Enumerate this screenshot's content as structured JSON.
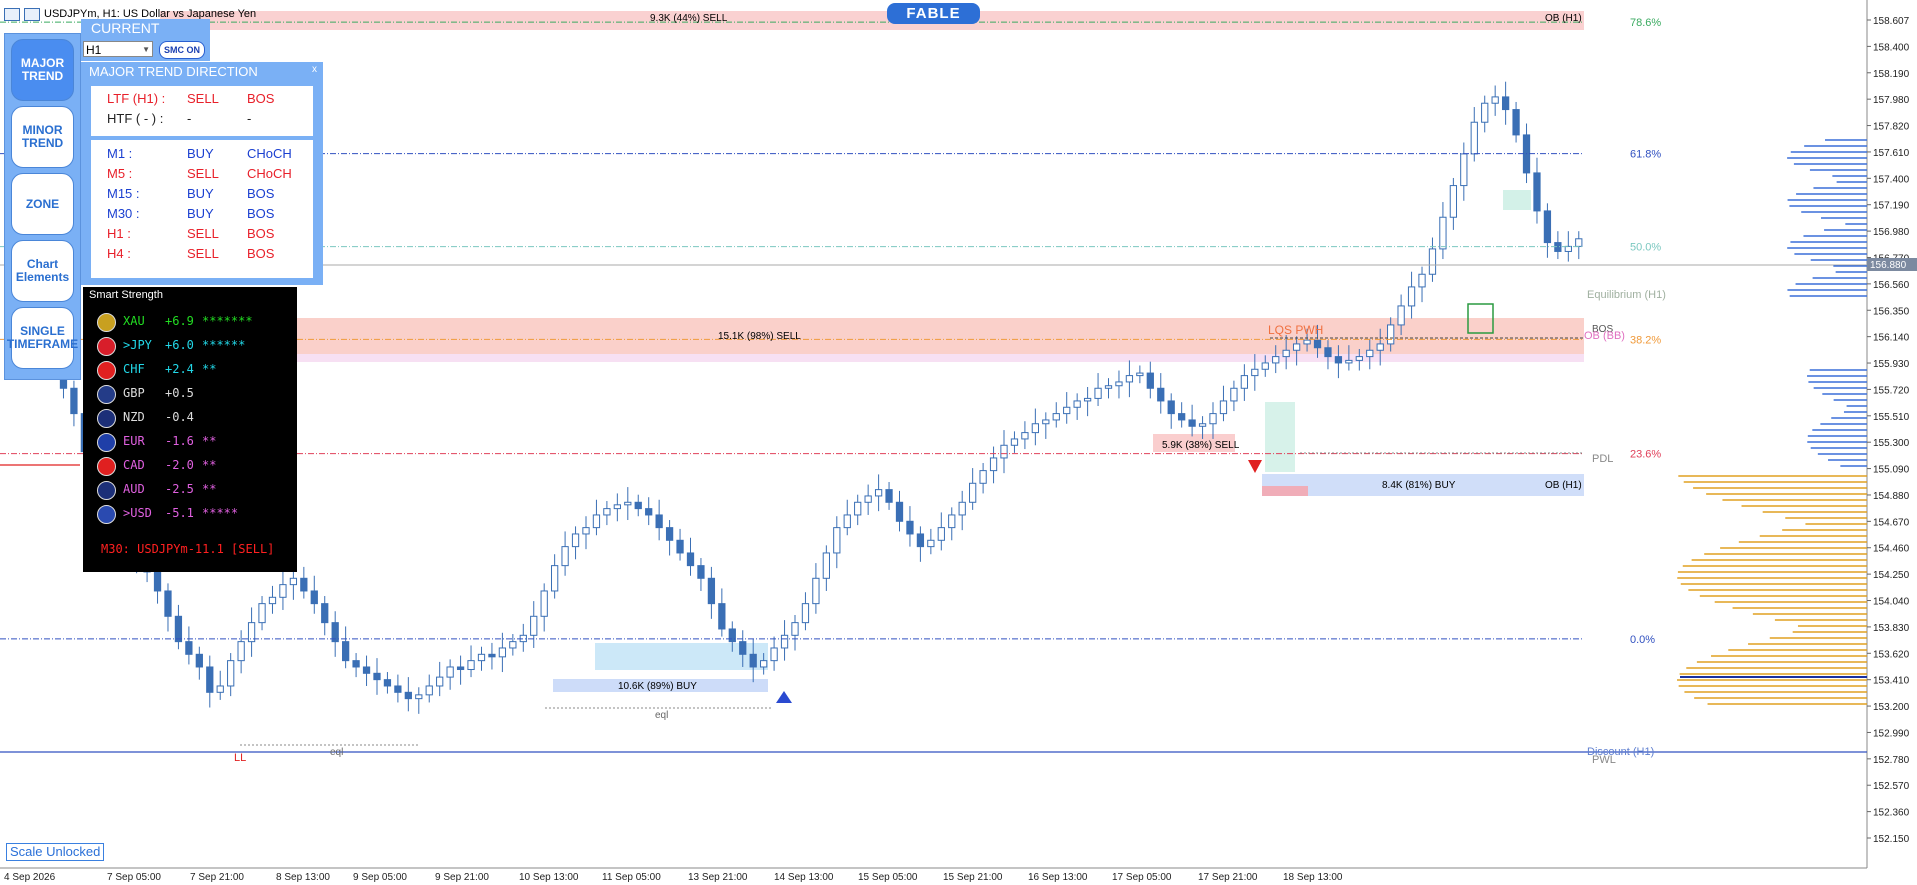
{
  "window": {
    "title": "USDJPYm, H1:  US Dollar vs Japanese Yen"
  },
  "brand": {
    "label": "FABLE"
  },
  "sidebar": {
    "items": [
      {
        "label": "MAJOR TREND",
        "active": true
      },
      {
        "label": "MINOR TREND",
        "active": false
      },
      {
        "label": "ZONE",
        "active": false
      },
      {
        "label": "Chart Elements",
        "active": false
      },
      {
        "label": "SINGLE TIMEFRAME",
        "active": false
      }
    ]
  },
  "current": {
    "title": "CURRENT",
    "timeframe": "H1",
    "smc_button": "SMC ON"
  },
  "trend": {
    "title": "MAJOR TREND DIRECTION",
    "close": "x",
    "ltf": {
      "label": "LTF (H1) :",
      "dir": "SELL",
      "struct": "BOS"
    },
    "htf": {
      "label": "HTF ( - ) :",
      "dir": "-",
      "struct": "-"
    },
    "rows": [
      {
        "tf": "M1 :",
        "dir": "BUY",
        "struct": "CHoCH",
        "color": "#1a3fd0"
      },
      {
        "tf": "M5 :",
        "dir": "SELL",
        "struct": "CHoCH",
        "color": "#e8202a"
      },
      {
        "tf": "M15 :",
        "dir": "BUY",
        "struct": "BOS",
        "color": "#1a3fd0"
      },
      {
        "tf": "M30 :",
        "dir": "BUY",
        "struct": "BOS",
        "color": "#1a3fd0"
      },
      {
        "tf": "H1 :",
        "dir": "SELL",
        "struct": "BOS",
        "color": "#e8202a"
      },
      {
        "tf": "H4 :",
        "dir": "SELL",
        "struct": "BOS",
        "color": "#e8202a"
      }
    ]
  },
  "strength": {
    "title": "Smart Strength",
    "rows": [
      {
        "cur": "XAU",
        "val": "+6.9",
        "stars": "*******",
        "color": "#22dd22",
        "flag": "#c8a020"
      },
      {
        "cur": ">JPY",
        "val": "+6.0",
        "stars": "******",
        "color": "#22d8e8",
        "flag": "#d81e2a"
      },
      {
        "cur": "CHF",
        "val": "+2.4",
        "stars": "**",
        "color": "#22d8e8",
        "flag": "#e02020"
      },
      {
        "cur": "GBP",
        "val": "+0.5",
        "stars": "",
        "color": "#dddddd",
        "flag": "#243c88"
      },
      {
        "cur": "NZD",
        "val": "-0.4",
        "stars": "",
        "color": "#dddddd",
        "flag": "#1c2f78"
      },
      {
        "cur": "EUR",
        "val": "-1.6",
        "stars": "**",
        "color": "#e060e0",
        "flag": "#1f3fa8"
      },
      {
        "cur": "CAD",
        "val": "-2.0",
        "stars": "**",
        "color": "#e060e0",
        "flag": "#e02020"
      },
      {
        "cur": "AUD",
        "val": "-2.5",
        "stars": "**",
        "color": "#e060e0",
        "flag": "#1c2f78"
      },
      {
        "cur": ">USD",
        "val": "-5.1",
        "stars": "*****",
        "color": "#e060e0",
        "flag": "#2a4ab0"
      }
    ],
    "signal": "M30: USDJPYm-11.1 [SELL]"
  },
  "scale_button": "Scale Unlocked",
  "chart_data": {
    "type": "candlestick",
    "symbol": "USDJPYm",
    "timeframe": "H1",
    "y_ticks": [
      "158.607",
      "158.400",
      "158.190",
      "157.980",
      "157.820",
      "157.610",
      "157.400",
      "157.190",
      "156.980",
      "156.770",
      "156.560",
      "156.350",
      "156.140",
      "155.930",
      "155.720",
      "155.510",
      "155.300",
      "155.090",
      "154.880",
      "154.670",
      "154.460",
      "154.250",
      "154.040",
      "153.830",
      "153.620",
      "153.410",
      "153.200",
      "152.990",
      "152.780",
      "152.570",
      "152.360",
      "152.150"
    ],
    "ylim": [
      152.07,
      158.7
    ],
    "x_ticks": [
      "4 Sep 2026",
      "7 Sep 05:00",
      "7 Sep 21:00",
      "8 Sep 13:00",
      "9 Sep 05:00",
      "9 Sep 21:00",
      "10 Sep 13:00",
      "11 Sep 05:00",
      "13 Sep 21:00",
      "14 Sep 13:00",
      "15 Sep 05:00",
      "15 Sep 21:00",
      "16 Sep 13:00",
      "17 Sep 05:00",
      "17 Sep 21:00",
      "18 Sep 13:00"
    ],
    "current_price": "156.880",
    "fib_levels": [
      {
        "label": "78.6%",
        "price": 158.59,
        "color": "#3aaa60"
      },
      {
        "label": "61.8%",
        "price": 157.552,
        "color": "#3050c0"
      },
      {
        "label": "50.0%",
        "price": 156.818,
        "color": "#7bc8c0"
      },
      {
        "label": "38.2%",
        "price": 156.086,
        "color": "#f09a3a"
      },
      {
        "label": "23.6%",
        "price": 155.184,
        "color": "#e0405a"
      },
      {
        "label": "0.0%",
        "price": 153.722,
        "color": "#3050c0"
      }
    ],
    "labels": {
      "ob_top": "OB (H1)",
      "ob_bottom": "OB (H1)",
      "ob_bb": "OB (BB)",
      "bos": "BOS",
      "equilibrium": "Equilibrium (H1)",
      "discount": "Discount (H1)",
      "pwl": "PWL",
      "pdl": "PDL",
      "lqs_pwh": "LQS PWH",
      "ll": "LL",
      "eql": "eql",
      "eql2": "eql",
      "zone1": "9.3K (44%) SELL",
      "zone2": "15.1K (98%) SELL",
      "zone3": "5.9K (38%) SELL",
      "zone4": "8.4K (81%) BUY",
      "zone5": "10.6K (89%) BUY"
    },
    "closes": [
      155.9,
      156.05,
      156.1,
      156.0,
      155.85,
      155.7,
      155.5,
      155.2,
      154.9,
      154.7,
      154.55,
      154.4,
      154.3,
      154.25,
      154.1,
      153.9,
      153.7,
      153.6,
      153.5,
      153.3,
      153.35,
      153.55,
      153.7,
      153.85,
      154.0,
      154.05,
      154.15,
      154.2,
      154.1,
      154.0,
      153.85,
      153.7,
      153.55,
      153.5,
      153.45,
      153.4,
      153.35,
      153.3,
      153.25,
      153.28,
      153.35,
      153.42,
      153.5,
      153.48,
      153.55,
      153.6,
      153.58,
      153.65,
      153.7,
      153.75,
      153.9,
      154.1,
      154.3,
      154.45,
      154.55,
      154.6,
      154.7,
      154.75,
      154.78,
      154.8,
      154.75,
      154.7,
      154.6,
      154.5,
      154.4,
      154.3,
      154.2,
      154.0,
      153.8,
      153.7,
      153.6,
      153.5,
      153.55,
      153.65,
      153.75,
      153.85,
      154.0,
      154.2,
      154.4,
      154.6,
      154.7,
      154.8,
      154.85,
      154.9,
      154.8,
      154.65,
      154.55,
      154.45,
      154.5,
      154.6,
      154.7,
      154.8,
      154.95,
      155.05,
      155.15,
      155.25,
      155.3,
      155.35,
      155.42,
      155.45,
      155.5,
      155.55,
      155.6,
      155.62,
      155.7,
      155.72,
      155.75,
      155.8,
      155.82,
      155.7,
      155.6,
      155.5,
      155.45,
      155.4,
      155.42,
      155.5,
      155.6,
      155.7,
      155.8,
      155.85,
      155.9,
      155.95,
      156.0,
      156.05,
      156.08,
      156.02,
      155.95,
      155.9,
      155.92,
      155.95,
      156.0,
      156.05,
      156.2,
      156.35,
      156.5,
      156.6,
      156.8,
      157.05,
      157.3,
      157.55,
      157.8,
      157.95,
      158.0,
      157.9,
      157.7,
      157.4,
      157.1,
      156.85,
      156.78,
      156.82,
      156.88
    ]
  }
}
